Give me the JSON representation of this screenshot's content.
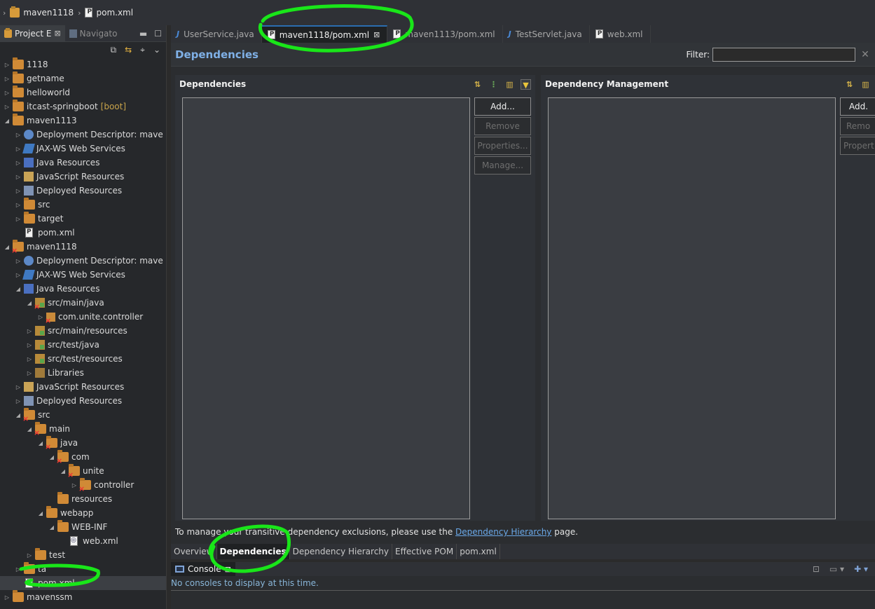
{
  "breadcrumb": {
    "project": "maven1118",
    "file": "pom.xml"
  },
  "left_panel": {
    "tabs": [
      {
        "label": "Project E",
        "close": "⊠"
      },
      {
        "label": "Navigato"
      }
    ]
  },
  "tree": [
    {
      "label": "1118",
      "icon": "folder-icon",
      "expanded": false
    },
    {
      "label": "getname",
      "icon": "folder-icon",
      "expanded": false
    },
    {
      "label": "helloworld",
      "icon": "folder-icon",
      "expanded": false
    },
    {
      "label": "itcast-springboot",
      "suffix": "[boot]",
      "icon": "folder-icon",
      "expanded": false
    },
    {
      "label": "maven1113",
      "icon": "folder-icon",
      "expanded": true
    },
    {
      "label": "Deployment Descriptor: mave",
      "icon": "globe-icon",
      "expanded": false
    },
    {
      "label": "JAX-WS Web Services",
      "icon": "ws-icon",
      "expanded": false
    },
    {
      "label": "Java Resources",
      "icon": "jar-icon",
      "expanded": false
    },
    {
      "label": "JavaScript Resources",
      "icon": "js-icon",
      "expanded": false
    },
    {
      "label": "Deployed Resources",
      "icon": "deployed-icon",
      "expanded": false
    },
    {
      "label": "src",
      "icon": "folder-icon",
      "expanded": false
    },
    {
      "label": "target",
      "icon": "folder-icon",
      "expanded": false
    },
    {
      "label": "pom.xml",
      "icon": "xml-file-icon"
    },
    {
      "label": "maven1118",
      "icon": "folder-error-icon",
      "expanded": true
    },
    {
      "label": "Deployment Descriptor: mave",
      "icon": "globe-icon",
      "expanded": false
    },
    {
      "label": "JAX-WS Web Services",
      "icon": "ws-icon",
      "expanded": false
    },
    {
      "label": "Java Resources",
      "icon": "jar-icon",
      "expanded": true
    },
    {
      "label": "src/main/java",
      "icon": "src-folder-error-icon",
      "expanded": true
    },
    {
      "label": "com.unite.controller",
      "icon": "package-error-icon",
      "expanded": false
    },
    {
      "label": "src/main/resources",
      "icon": "src-folder-icon",
      "expanded": false
    },
    {
      "label": "src/test/java",
      "icon": "src-folder-icon",
      "expanded": false
    },
    {
      "label": "src/test/resources",
      "icon": "src-folder-icon",
      "expanded": false
    },
    {
      "label": "Libraries",
      "icon": "library-icon",
      "expanded": false
    },
    {
      "label": "JavaScript Resources",
      "icon": "js-icon",
      "expanded": false
    },
    {
      "label": "Deployed Resources",
      "icon": "deployed-icon",
      "expanded": false
    },
    {
      "label": "src",
      "icon": "folder-error-icon",
      "expanded": true
    },
    {
      "label": "main",
      "icon": "folder-error-icon",
      "expanded": true
    },
    {
      "label": "java",
      "icon": "folder-error-icon",
      "expanded": true
    },
    {
      "label": "com",
      "icon": "folder-error-icon",
      "expanded": true
    },
    {
      "label": "unite",
      "icon": "folder-error-icon",
      "expanded": true
    },
    {
      "label": "controller",
      "icon": "folder-error-icon",
      "expanded": false
    },
    {
      "label": "resources",
      "icon": "folder-icon"
    },
    {
      "label": "webapp",
      "icon": "folder-icon",
      "expanded": true
    },
    {
      "label": "WEB-INF",
      "icon": "folder-icon",
      "expanded": true
    },
    {
      "label": "web.xml",
      "icon": "web-xml-icon"
    },
    {
      "label": "test",
      "icon": "folder-icon",
      "expanded": false
    },
    {
      "label": "ta",
      "icon": "folder-icon",
      "expanded": false
    },
    {
      "label": "pom.xml",
      "icon": "xml-file-icon",
      "selected": true
    },
    {
      "label": "mavenssm",
      "icon": "folder-icon",
      "expanded": false
    }
  ],
  "editor": {
    "tabs": [
      {
        "label": "UserService.java",
        "icon": "java-icon"
      },
      {
        "label": "maven1118/pom.xml",
        "icon": "xml-file-icon",
        "active": true,
        "close": "⊠"
      },
      {
        "label": "maven1113/pom.xml",
        "icon": "xml-file-icon"
      },
      {
        "label": "TestServlet.java",
        "icon": "java-icon"
      },
      {
        "label": "web.xml",
        "icon": "web-xml-icon"
      }
    ],
    "title": "Dependencies",
    "filter_label": "Filter:",
    "filter_value": "",
    "dependencies": {
      "heading": "Dependencies",
      "buttons": {
        "add": "Add...",
        "remove": "Remove",
        "properties": "Properties...",
        "manage": "Manage..."
      }
    },
    "dependency_management": {
      "heading": "Dependency Management",
      "buttons": {
        "add": "Add.",
        "remove": "Remo",
        "properties": "Propert"
      }
    },
    "hint_before": "To manage your transitive dependency exclusions, please use the",
    "hint_link": "Dependency Hierarchy",
    "hint_after": "page."
  },
  "page_tabs": [
    "Overview",
    "Dependencies",
    "Dependency Hierarchy",
    "Effective POM",
    "pom.xml"
  ],
  "active_page_tab": "Dependencies",
  "console": {
    "tab": "Console",
    "close": "⊠",
    "message": "No consoles to display at this time."
  },
  "colors": {
    "annotation": "#19e619",
    "link": "#6aa8e8",
    "title": "#7fb0e6"
  }
}
